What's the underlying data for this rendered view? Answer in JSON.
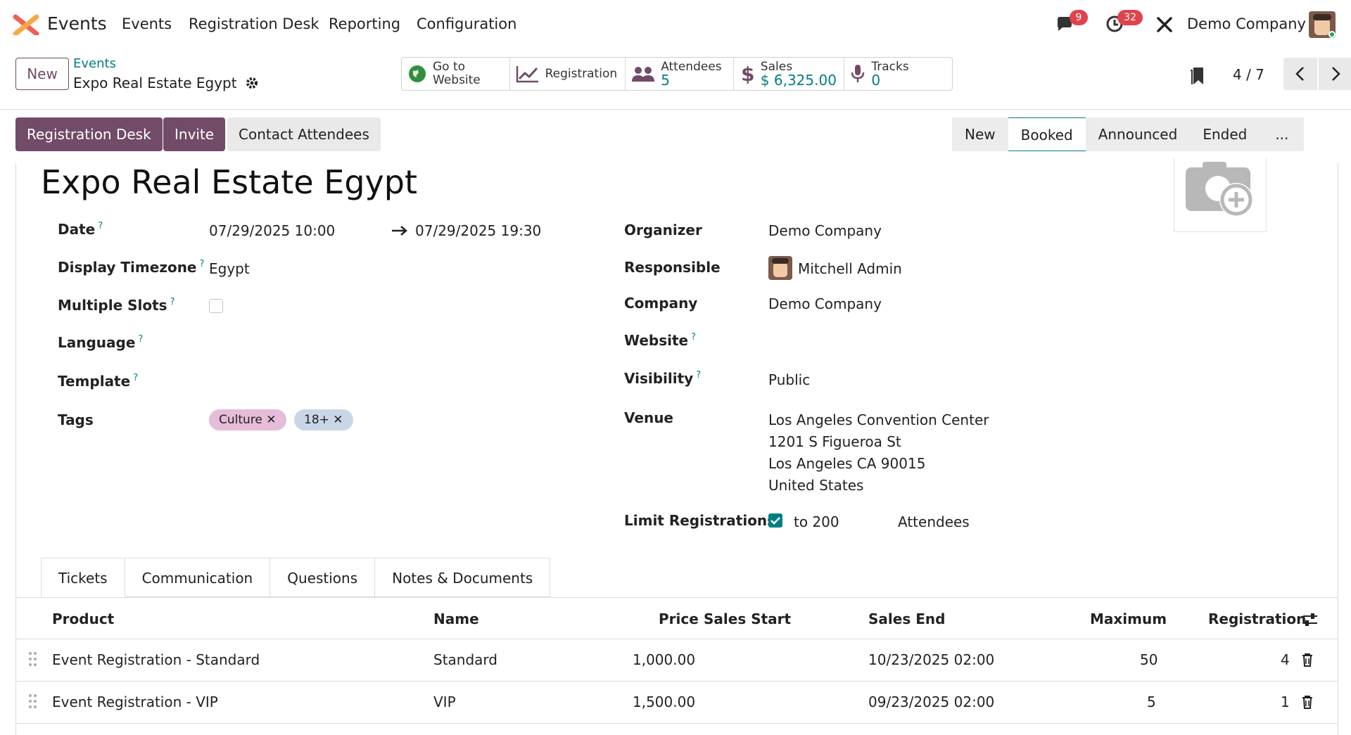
{
  "navbar": {
    "app_name": "Events",
    "menu": [
      "Events",
      "Registration Desk",
      "Reporting",
      "Configuration"
    ],
    "messages_count": "9",
    "activities_count": "32",
    "company": "Demo Company"
  },
  "control_panel": {
    "new_label": "New",
    "breadcrumb_parent": "Events",
    "breadcrumb_current": "Expo Real Estate Egypt",
    "smart_buttons": {
      "website": {
        "line1": "Go to",
        "line2": "Website"
      },
      "registration": {
        "label": "Registration"
      },
      "attendees": {
        "label": "Attendees",
        "value": "5"
      },
      "sales": {
        "label": "Sales",
        "value": "$ 6,325.00"
      },
      "tracks": {
        "label": "Tracks",
        "value": "0"
      }
    },
    "pager": "4 / 7"
  },
  "actions": {
    "registration_desk": "Registration Desk",
    "invite": "Invite",
    "contact_attendees": "Contact Attendees"
  },
  "stages": [
    "New",
    "Booked",
    "Announced",
    "Ended",
    "..."
  ],
  "active_stage": "Booked",
  "form": {
    "title": "Expo Real Estate Egypt",
    "left": {
      "date_label": "Date",
      "date_start": "07/29/2025 10:00",
      "date_end": "07/29/2025 19:30",
      "timezone_label": "Display Timezone",
      "timezone": "Egypt",
      "multi_slots_label": "Multiple Slots",
      "language_label": "Language",
      "template_label": "Template",
      "tags_label": "Tags",
      "tags": [
        {
          "name": "Culture",
          "color": "#e6bcd8"
        },
        {
          "name": "18+",
          "color": "#c9d6e8"
        }
      ]
    },
    "right": {
      "organizer_label": "Organizer",
      "organizer": "Demo Company",
      "responsible_label": "Responsible",
      "responsible": "Mitchell Admin",
      "company_label": "Company",
      "company": "Demo Company",
      "website_label": "Website",
      "visibility_label": "Visibility",
      "visibility": "Public",
      "venue_label": "Venue",
      "venue_lines": [
        "Los Angeles Convention Center",
        "1201 S Figueroa St",
        "Los Angeles CA 90015",
        "United States"
      ],
      "limit_label": "Limit Registrations",
      "limit_to": "to 200",
      "limit_unit": "Attendees"
    }
  },
  "tabs": [
    "Tickets",
    "Communication",
    "Questions",
    "Notes & Documents"
  ],
  "tickets": {
    "headers": [
      "Product",
      "Name",
      "Price",
      "Sales Start",
      "Sales End",
      "Maximum",
      "Registration"
    ],
    "rows": [
      {
        "product": "Event Registration - Standard",
        "name": "Standard",
        "price": "1,000.00",
        "start": "",
        "end": "10/23/2025 02:00",
        "max": "50",
        "reg": "4"
      },
      {
        "product": "Event Registration - VIP",
        "name": "VIP",
        "price": "1,500.00",
        "start": "",
        "end": "09/23/2025 02:00",
        "max": "5",
        "reg": "1"
      }
    ]
  },
  "colors": {
    "brand": "#714b67",
    "accent": "#017e84",
    "badge": "#e0434b"
  }
}
